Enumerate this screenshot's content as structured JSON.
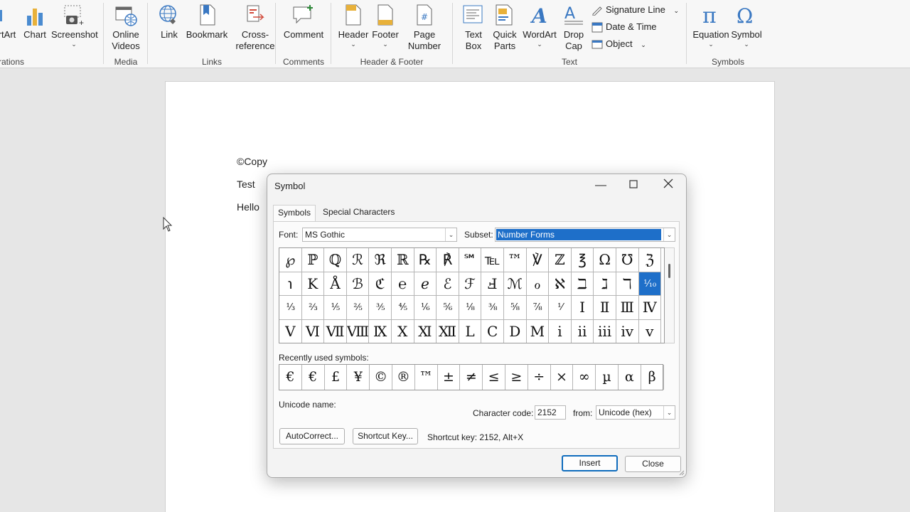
{
  "ribbon": {
    "groups": {
      "illustrations": {
        "label": "rations",
        "buttons": [
          {
            "label": "rtArt"
          },
          {
            "label": "Chart"
          },
          {
            "label": "Screenshot"
          }
        ]
      },
      "media": {
        "label": "Media",
        "buttons": [
          {
            "label": "Online Videos",
            "line1": "Online",
            "line2": "Videos"
          }
        ]
      },
      "links": {
        "label": "Links",
        "buttons": [
          {
            "label": "Link"
          },
          {
            "label": "Bookmark"
          },
          {
            "label": "Cross-reference",
            "line1": "Cross-",
            "line2": "reference"
          }
        ]
      },
      "comments": {
        "label": "Comments",
        "buttons": [
          {
            "label": "Comment"
          }
        ]
      },
      "header_footer": {
        "label": "Header & Footer",
        "buttons": [
          {
            "label": "Header"
          },
          {
            "label": "Footer"
          },
          {
            "label": "Page Number",
            "line1": "Page",
            "line2": "Number"
          }
        ]
      },
      "text": {
        "label": "Text",
        "buttons": [
          {
            "label": "Text Box",
            "line1": "Text",
            "line2": "Box"
          },
          {
            "label": "Quick Parts",
            "line1": "Quick",
            "line2": "Parts"
          },
          {
            "label": "WordArt"
          },
          {
            "label": "Drop Cap",
            "line1": "Drop",
            "line2": "Cap"
          }
        ],
        "small": [
          {
            "label": "Signature Line"
          },
          {
            "label": "Date & Time"
          },
          {
            "label": "Object"
          }
        ]
      },
      "symbols": {
        "label": "Symbols",
        "buttons": [
          {
            "label": "Equation"
          },
          {
            "label": "Symbol"
          }
        ]
      }
    }
  },
  "document": {
    "lines": [
      "©Copy",
      "Test",
      "Hello"
    ]
  },
  "dialog": {
    "title": "Symbol",
    "tabs": [
      "Symbols",
      "Special Characters"
    ],
    "font_label": "Font:",
    "font_value": "MS Gothic",
    "subset_label": "Subset:",
    "subset_value": "Number Forms",
    "grid": [
      [
        "℘",
        "ℙ",
        "ℚ",
        "ℛ",
        "ℜ",
        "ℝ",
        "℞",
        "℟",
        "℠",
        "℡",
        "™",
        "℣",
        "ℤ",
        "℥",
        "Ω",
        "℧",
        "ℨ"
      ],
      [
        "℩",
        "K",
        "Å",
        "ℬ",
        "ℭ",
        "℮",
        "ℯ",
        "ℰ",
        "ℱ",
        "Ⅎ",
        "ℳ",
        "ℴ",
        "ℵ",
        "ℶ",
        "ℷ",
        "ℸ",
        "⅒"
      ],
      [
        "⅓",
        "⅔",
        "⅕",
        "⅖",
        "⅗",
        "⅘",
        "⅙",
        "⅚",
        "⅛",
        "⅜",
        "⅝",
        "⅞",
        "⅟",
        "Ⅰ",
        "Ⅱ",
        "Ⅲ",
        "Ⅳ"
      ],
      [
        "Ⅴ",
        "Ⅵ",
        "Ⅶ",
        "Ⅷ",
        "Ⅸ",
        "Ⅹ",
        "Ⅺ",
        "Ⅻ",
        "Ⅼ",
        "Ⅽ",
        "Ⅾ",
        "Ⅿ",
        "ⅰ",
        "ⅱ",
        "ⅲ",
        "ⅳ",
        "ⅴ"
      ]
    ],
    "selected_char": "⅒",
    "recent_label": "Recently used symbols:",
    "recent": [
      "€",
      "€",
      "£",
      "¥",
      "©",
      "®",
      "™",
      "±",
      "≠",
      "≤",
      "≥",
      "÷",
      "×",
      "∞",
      "µ",
      "α",
      "β"
    ],
    "unicode_name_label": "Unicode name:",
    "char_code_label": "Character code:",
    "char_code_value": "2152",
    "from_label": "from:",
    "from_value": "Unicode (hex)",
    "autocorrect_label": "AutoCorrect...",
    "shortcut_key_btn_label": "Shortcut Key...",
    "shortcut_key_text": "Shortcut key: 2152, Alt+X",
    "insert_label": "Insert",
    "close_label": "Close"
  },
  "colors": {
    "accent": "#1e6fc9",
    "ribbon_bg": "#f7f7f7",
    "canvas_bg": "#e6e6e6"
  }
}
